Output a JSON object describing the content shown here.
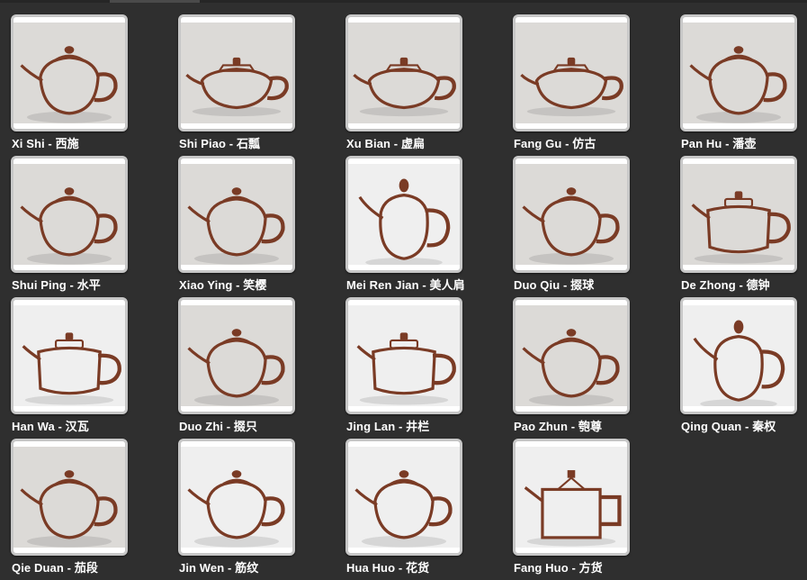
{
  "gallery": {
    "items": [
      {
        "label": "Xi Shi - 西施",
        "style": "sepia",
        "shape": "round"
      },
      {
        "label": "Shi Piao - 石瓢",
        "style": "sepia",
        "shape": "flat"
      },
      {
        "label": "Xu Bian - 虚扁",
        "style": "sepia",
        "shape": "flat"
      },
      {
        "label": "Fang Gu - 仿古",
        "style": "sepia",
        "shape": "flat"
      },
      {
        "label": "Pan Hu - 潘壶",
        "style": "sepia",
        "shape": "round"
      },
      {
        "label": "Shui Ping - 水平",
        "style": "sepia",
        "shape": "round"
      },
      {
        "label": "Xiao Ying - 笑樱",
        "style": "sepia",
        "shape": "round"
      },
      {
        "label": "Mei Ren Jian - 美人肩",
        "style": "sketch",
        "shape": "tall"
      },
      {
        "label": "Duo Qiu - 掇球",
        "style": "sepia",
        "shape": "round"
      },
      {
        "label": "De Zhong - 德钟",
        "style": "sepia",
        "shape": "drum"
      },
      {
        "label": "Han Wa - 汉瓦",
        "style": "sketch",
        "shape": "drum"
      },
      {
        "label": "Duo Zhi - 掇只",
        "style": "sepia",
        "shape": "round"
      },
      {
        "label": "Jing Lan - 井栏",
        "style": "sketch",
        "shape": "drum"
      },
      {
        "label": "Pao Zhun - 匏尊",
        "style": "sepia",
        "shape": "round"
      },
      {
        "label": "Qing Quan - 秦权",
        "style": "sketch",
        "shape": "tall"
      },
      {
        "label": "Qie Duan - 茄段",
        "style": "sepia",
        "shape": "round"
      },
      {
        "label": "Jin Wen - 筋纹",
        "style": "sketch",
        "shape": "round"
      },
      {
        "label": "Hua Huo - 花货",
        "style": "sketch",
        "shape": "round"
      },
      {
        "label": "Fang Huo - 方货",
        "style": "sketch",
        "shape": "square"
      }
    ]
  },
  "colors": {
    "background": "#2f2f2f",
    "thumb_border": "#c7c7c7",
    "caption_text": "#ffffff",
    "ink": "#7a3b25"
  },
  "icons": {
    "thumbnail": "teapot-icon"
  }
}
